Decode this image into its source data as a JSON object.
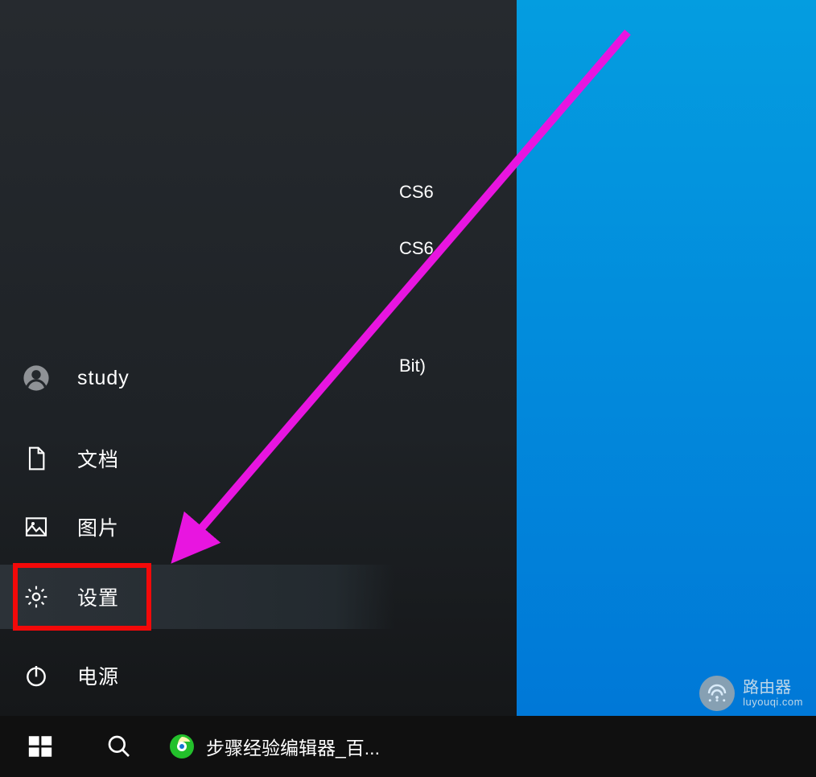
{
  "railItems": {
    "user": "study",
    "documents": "文档",
    "pictures": "图片",
    "settings": "设置",
    "power": "电源"
  },
  "appFragments": {
    "cs6_1": "CS6",
    "cs6_2": "CS6",
    "bit": "Bit)"
  },
  "taskbar": {
    "taskTitle": "步骤经验编辑器_百..."
  },
  "watermark": {
    "title": "路由器",
    "sub": "luyouqi.com"
  },
  "colors": {
    "annotationArrow": "#e815e0",
    "highlightBorder": "#f30909",
    "desktopTop": "#049de0"
  }
}
